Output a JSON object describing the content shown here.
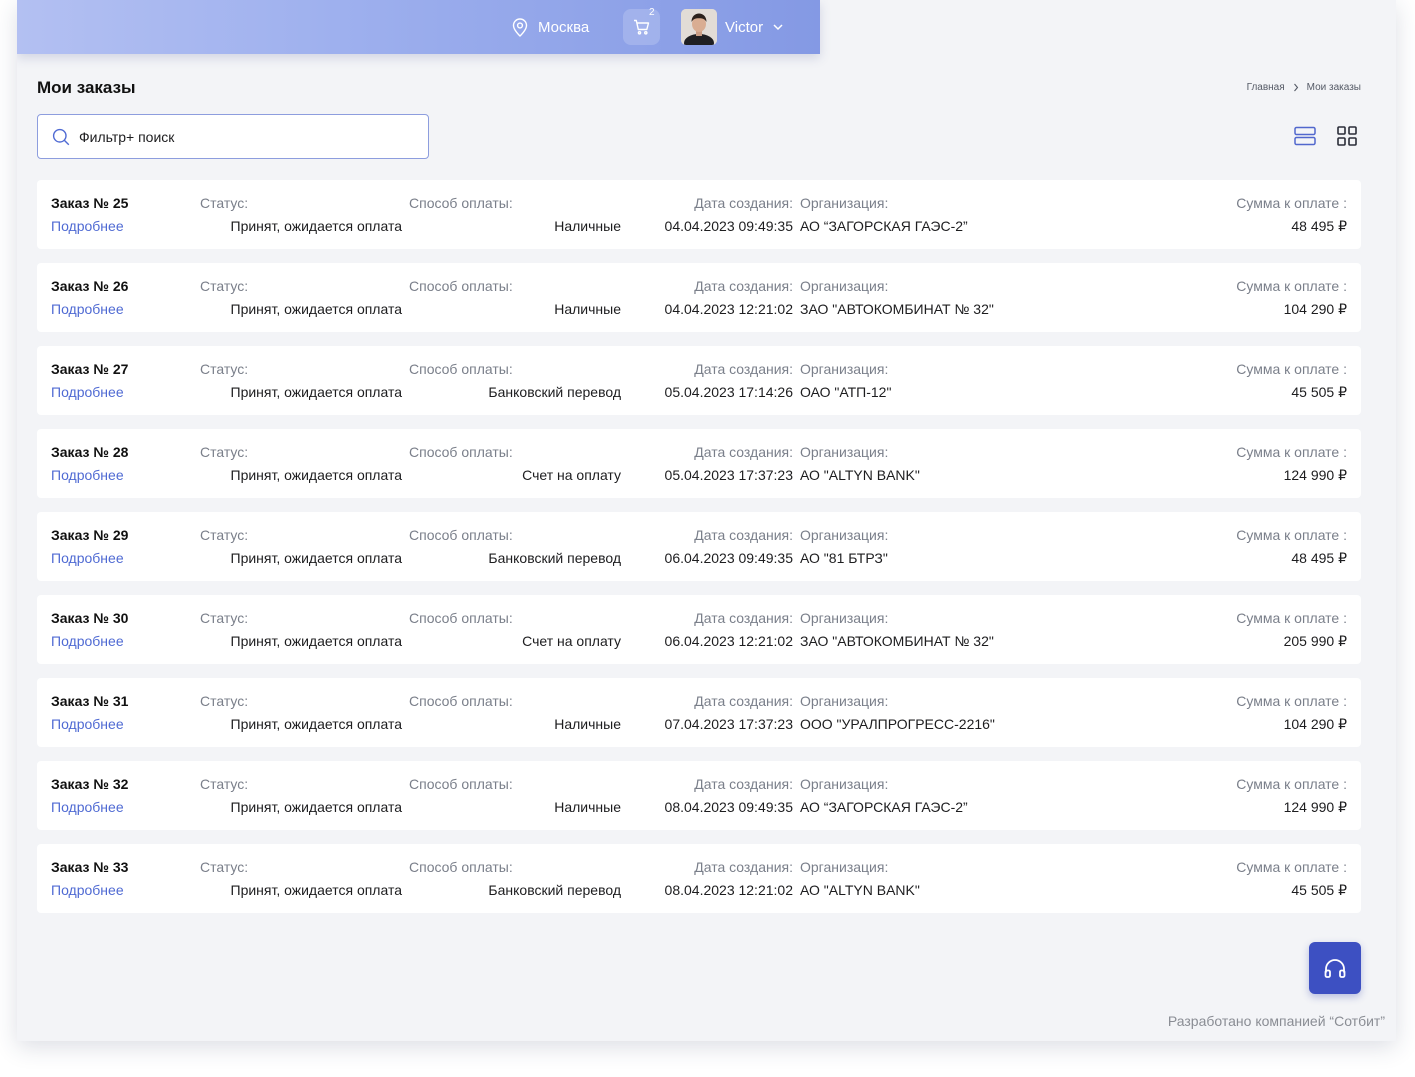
{
  "header": {
    "city": "Москва",
    "cart_count": "2",
    "user_name": "Victor"
  },
  "page": {
    "title": "Мои заказы",
    "breadcrumb": [
      "Главная",
      "Мои заказы"
    ]
  },
  "search": {
    "placeholder": "Фильтр+ поиск",
    "value": ""
  },
  "labels": {
    "status": "Статус:",
    "payment": "Способ оплаты:",
    "created": "Дата создания:",
    "organization": "Организация:",
    "amount": "Сумма к оплате :",
    "details": "Подробнее"
  },
  "orders": [
    {
      "number": "Заказ № 25",
      "status": "Принят, ожидается оплата",
      "payment": "Наличные",
      "date": "04.04.2023 09:49:35",
      "organization": "АО “ЗАГОРСКАЯ ГАЭС-2”",
      "amount": "48 495 ₽"
    },
    {
      "number": "Заказ № 26",
      "status": "Принят, ожидается оплата",
      "payment": "Наличные",
      "date": "04.04.2023 12:21:02",
      "organization": "ЗАО \"АВТОКОМБИНАТ № 32\"",
      "amount": "104 290 ₽"
    },
    {
      "number": "Заказ № 27",
      "status": "Принят, ожидается оплата",
      "payment": "Банковский перевод",
      "date": "05.04.2023 17:14:26",
      "organization": "ОАО \"АТП-12\"",
      "amount": "45 505 ₽"
    },
    {
      "number": "Заказ № 28",
      "status": "Принят, ожидается оплата",
      "payment": "Счет на оплату",
      "date": "05.04.2023 17:37:23",
      "organization": "АО \"ALTYN BANK\"",
      "amount": "124 990 ₽"
    },
    {
      "number": "Заказ № 29",
      "status": "Принят, ожидается оплата",
      "payment": "Банковский перевод",
      "date": "06.04.2023 09:49:35",
      "organization": "АО \"81 БТРЗ\"",
      "amount": "48 495 ₽"
    },
    {
      "number": "Заказ № 30",
      "status": "Принят, ожидается оплата",
      "payment": "Счет на оплату",
      "date": "06.04.2023 12:21:02",
      "organization": "ЗАО \"АВТОКОМБИНАТ № 32\"",
      "amount": "205 990 ₽"
    },
    {
      "number": "Заказ № 31",
      "status": "Принят, ожидается оплата",
      "payment": "Наличные",
      "date": "07.04.2023 17:37:23",
      "organization": "ООО \"УРАЛПРОГРЕСС-2216\"",
      "amount": "104 290 ₽"
    },
    {
      "number": "Заказ № 32",
      "status": "Принят, ожидается оплата",
      "payment": "Наличные",
      "date": "08.04.2023 09:49:35",
      "organization": "АО “ЗАГОРСКАЯ ГАЭС-2”",
      "amount": "124 990 ₽"
    },
    {
      "number": "Заказ № 33",
      "status": "Принят, ожидается оплата",
      "payment": "Банковский перевод",
      "date": "08.04.2023 12:21:02",
      "organization": "АО \"ALTYN BANK\"",
      "amount": "45 505 ₽"
    }
  ],
  "footer": {
    "credit": "Разработано компанией “Сотбит”"
  },
  "icons": {
    "location": "map-pin-icon",
    "cart": "cart-icon",
    "chevron": "chevron-down-icon",
    "breadcrumb_separator": "chevron-right-icon",
    "search": "search-icon",
    "view_list": "list-view-icon",
    "view_grid": "grid-view-icon",
    "support": "headphones-icon"
  },
  "colors": {
    "accent": "#3d50c2",
    "link": "#4f6ad3",
    "header_gradient_start": "#b3c0f2",
    "header_gradient_end": "#8499e4"
  }
}
